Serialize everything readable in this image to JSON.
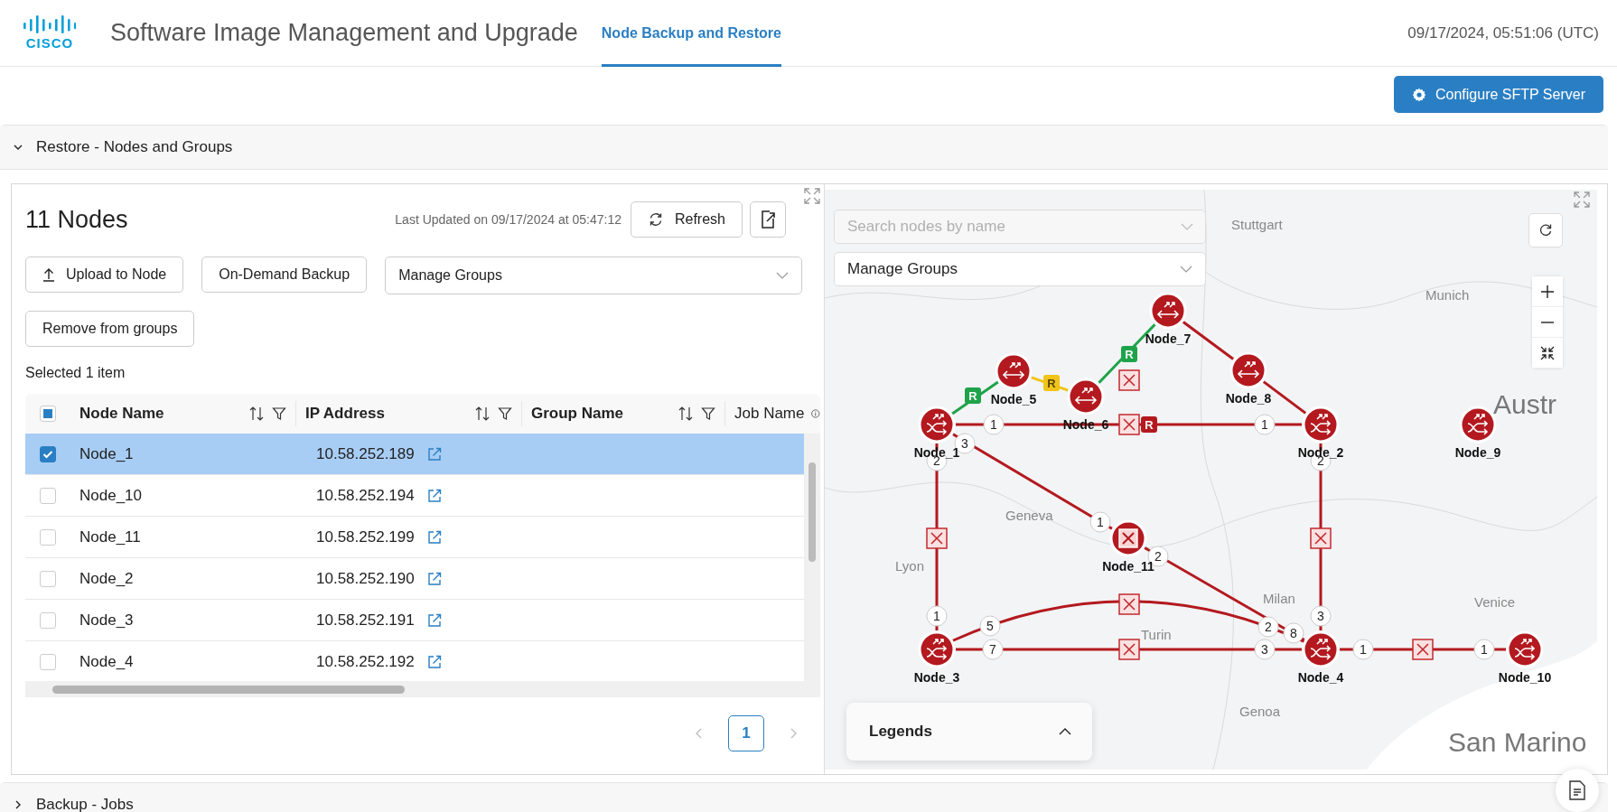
{
  "header": {
    "logo": "CISCO",
    "title": "Software Image Management and Upgrade",
    "tabs": [
      {
        "label": "Node Backup and Restore",
        "selected": true
      }
    ],
    "timestamp": "09/17/2024, 05:51:06 (UTC)"
  },
  "toolbar": {
    "configure_button": "Configure SFTP Server"
  },
  "sections": [
    {
      "title": "Restore - Nodes and Groups",
      "expanded": true
    },
    {
      "title": "Backup - Jobs",
      "expanded": false
    }
  ],
  "nodes_panel": {
    "title": "11 Nodes",
    "last_updated": "Last Updated on 09/17/2024 at 05:47:12",
    "refresh_button": "Refresh",
    "upload_button": "Upload to Node",
    "backup_button": "On-Demand Backup",
    "manage_groups": {
      "value": "Manage Groups"
    },
    "remove_button": "Remove from groups",
    "selection_summary": "Selected 1 item",
    "select_all": {
      "checked": false,
      "partial": true
    },
    "columns": [
      {
        "label": "Node Name",
        "kind": "sortable"
      },
      {
        "label": "IP Address",
        "kind": "sortable"
      },
      {
        "label": "Group Name",
        "kind": "sortable"
      },
      {
        "label": "Job Name",
        "kind": "info"
      }
    ],
    "rows": [
      {
        "node_name": "Node_1",
        "ip": "10.58.252.189",
        "selected": true
      },
      {
        "node_name": "Node_10",
        "ip": "10.58.252.194",
        "selected": false
      },
      {
        "node_name": "Node_11",
        "ip": "10.58.252.199",
        "selected": false
      },
      {
        "node_name": "Node_2",
        "ip": "10.58.252.190",
        "selected": false
      },
      {
        "node_name": "Node_3",
        "ip": "10.58.252.191",
        "selected": false
      },
      {
        "node_name": "Node_4",
        "ip": "10.58.252.192",
        "selected": false
      }
    ],
    "pages": [
      {
        "label": "1",
        "selected": true
      }
    ]
  },
  "map": {
    "search": {
      "placeholder": "Search nodes by name"
    },
    "manage_groups": {
      "value": "Manage Groups"
    },
    "place_labels": [
      {
        "text": "Stuttgart",
        "kind": "city"
      },
      {
        "text": "Munich",
        "kind": "city"
      },
      {
        "text": "Austr",
        "kind": "country"
      },
      {
        "text": "Geneva",
        "kind": "city"
      },
      {
        "text": "Lyon",
        "kind": "city"
      },
      {
        "text": "Milan",
        "kind": "city"
      },
      {
        "text": "Venice",
        "kind": "city"
      },
      {
        "text": "Turin",
        "kind": "city"
      },
      {
        "text": "Genoa",
        "kind": "city"
      },
      {
        "text": "San Marino",
        "kind": "country"
      }
    ],
    "nodes": [
      {
        "label": "Node_1",
        "kind": "switch"
      },
      {
        "label": "Node_2",
        "kind": "switch"
      },
      {
        "label": "Node_3",
        "kind": "switch"
      },
      {
        "label": "Node_4",
        "kind": "switch"
      },
      {
        "label": "Node_5",
        "kind": "router"
      },
      {
        "label": "Node_6",
        "kind": "router"
      },
      {
        "label": "Node_7",
        "kind": "router"
      },
      {
        "label": "Node_8",
        "kind": "router"
      },
      {
        "label": "Node_9",
        "kind": "switch"
      },
      {
        "label": "Node_10",
        "kind": "switch"
      },
      {
        "label": "Node_11",
        "kind": "failed"
      }
    ],
    "links": [
      {
        "color": "#b3191f",
        "ports": {
          "from": "1",
          "to": "1"
        },
        "failed": true,
        "tag": "R"
      },
      {
        "color": "#1fa34a",
        "tag": "R"
      },
      {
        "color": "#f0c419",
        "tag": "R"
      },
      {
        "color": "#1fa34a",
        "tag": "R",
        "failed": true
      },
      {
        "color": "#b3191f"
      },
      {
        "color": "#b3191f"
      },
      {
        "color": "#b3191f",
        "ports": {
          "from": "2",
          "to": "1"
        },
        "failed": true
      },
      {
        "color": "#b3191f",
        "ports": {
          "from": "2",
          "to": "3"
        },
        "failed": true
      },
      {
        "color": "#b3191f",
        "ports": {
          "from": "3",
          "to": "1"
        }
      },
      {
        "color": "#b3191f",
        "ports": {
          "from": "2",
          "to": "2"
        }
      },
      {
        "color": "#b3191f",
        "kind": "arc",
        "ports": {
          "from": "5",
          "to": "8"
        },
        "failed": true
      },
      {
        "color": "#b3191f",
        "ports": {
          "from": "7",
          "to": "3"
        },
        "failed": true
      },
      {
        "color": "#b3191f",
        "ports": {
          "from": "1",
          "to": "1"
        },
        "failed": true
      }
    ],
    "legends": {
      "title": "Legends",
      "expanded": false
    }
  }
}
